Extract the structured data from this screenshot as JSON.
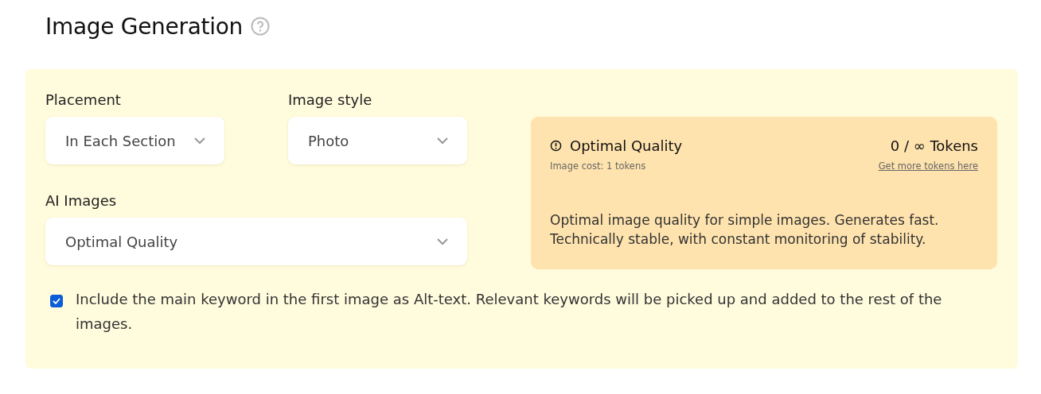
{
  "title": "Image Generation",
  "fields": [
    {
      "label": "Placement",
      "value": "In Each Section"
    },
    {
      "label": "Image style",
      "value": "Photo"
    },
    {
      "label": "AI Images",
      "value": "Optimal Quality"
    }
  ],
  "info_card": {
    "title": "Optimal Quality",
    "tokens": "0 / ∞ Tokens",
    "cost": "Image cost: 1 tokens",
    "link": "Get more tokens here",
    "description": "Optimal image quality for simple images. Generates fast. Technically stable, with constant monitoring of stability."
  },
  "alt_text_option": {
    "label": "Include the main keyword in the first image as Alt-text. Relevant keywords will be picked up and added to the rest of the images.",
    "checked": true
  }
}
